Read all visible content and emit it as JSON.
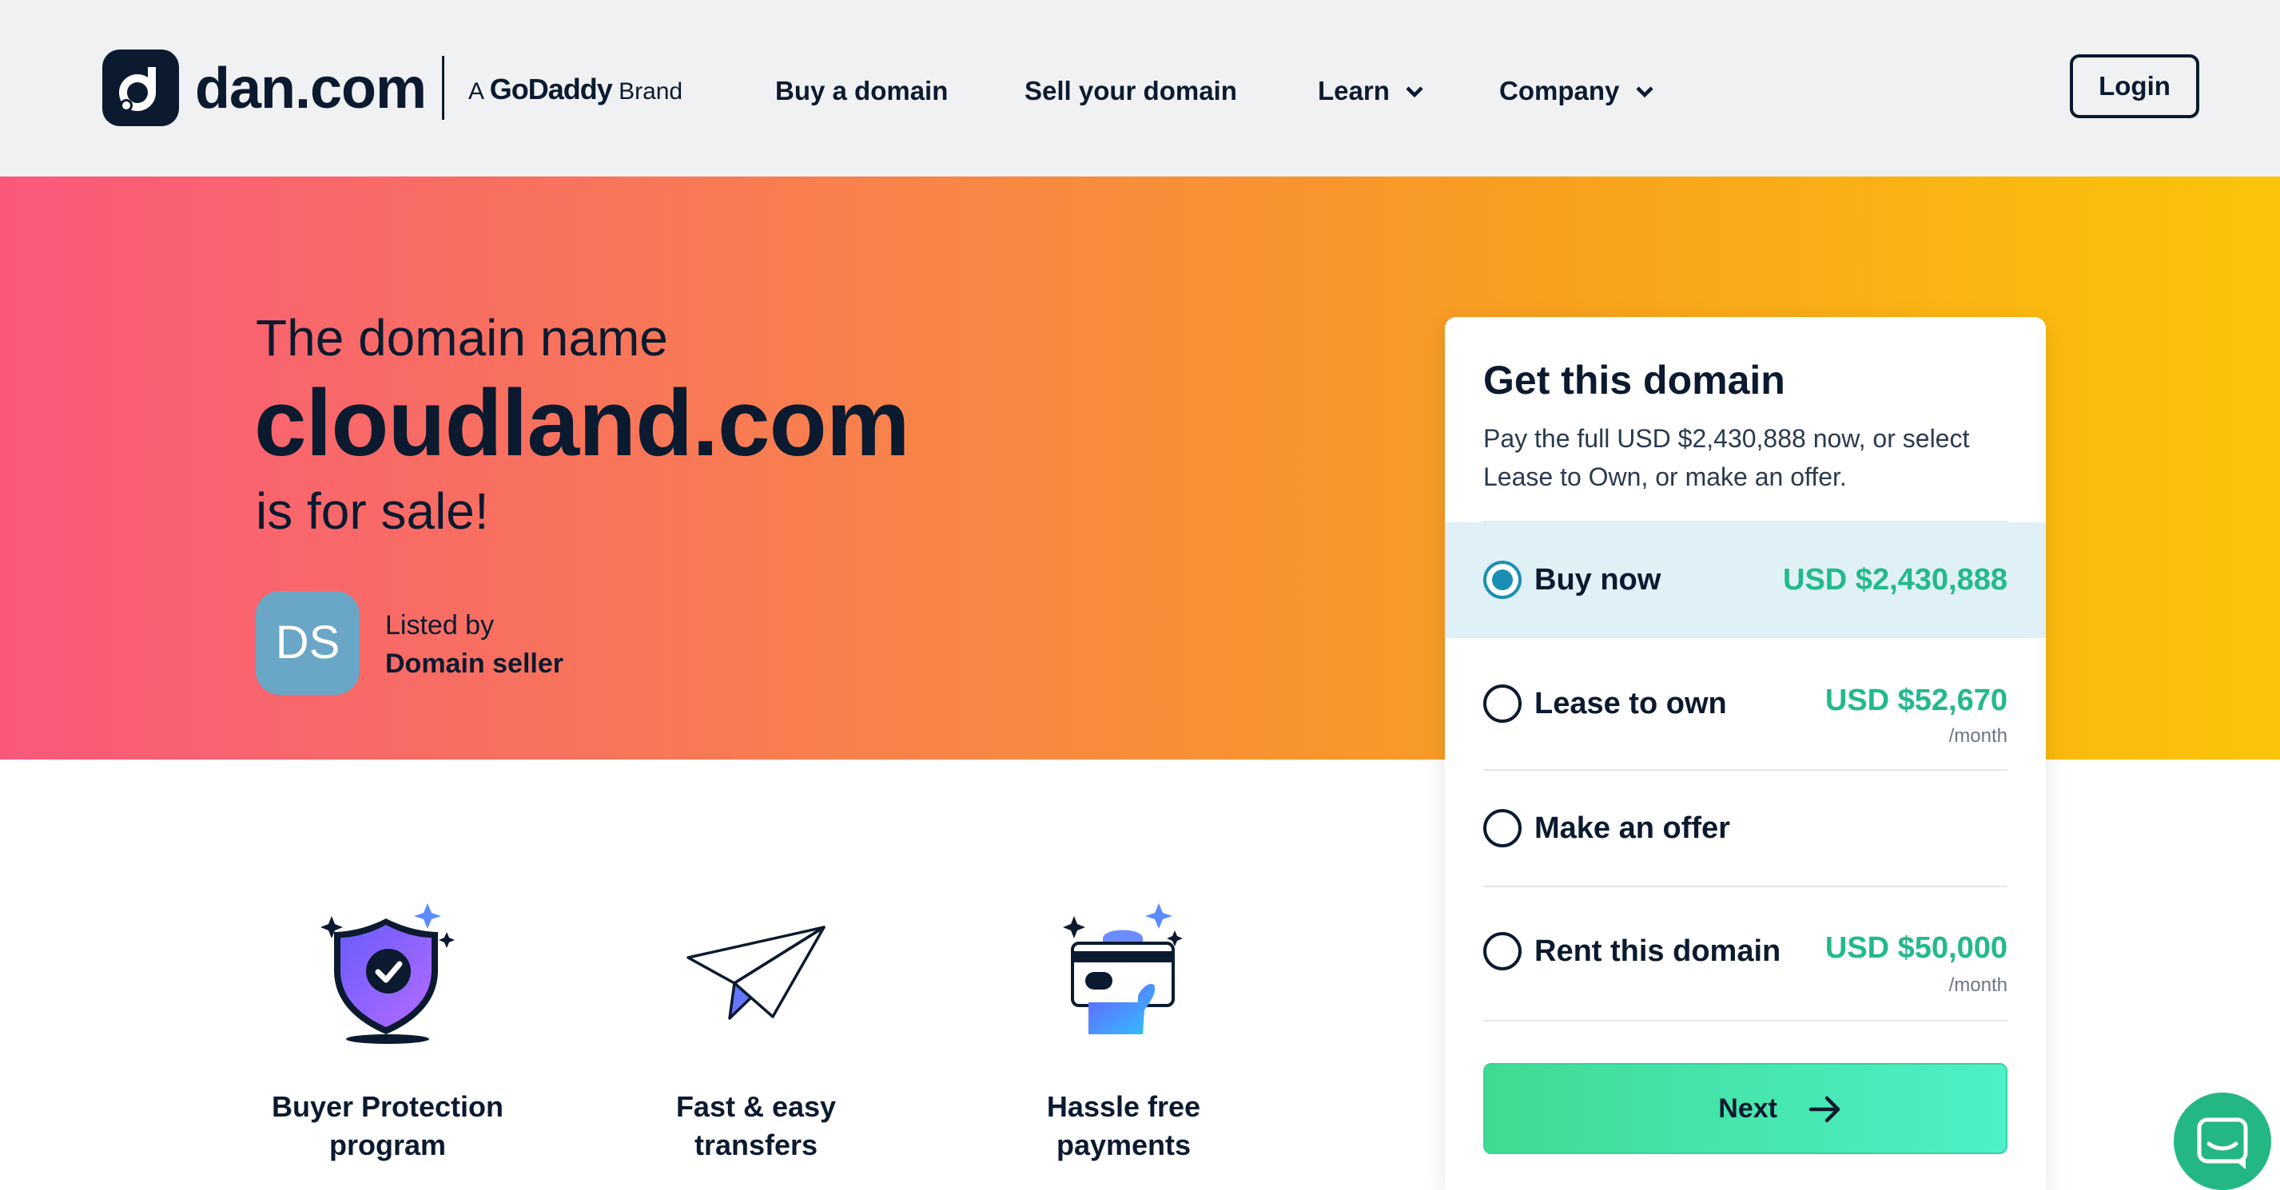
{
  "header": {
    "logo_text": "dan.com",
    "brand_prefix": "A",
    "brand_name": "GoDaddy",
    "brand_suffix": "Brand",
    "nav": [
      {
        "label": "Buy a domain"
      },
      {
        "label": "Sell your domain"
      },
      {
        "label": "Learn",
        "icon": "chevron-down-icon"
      },
      {
        "label": "Company",
        "icon": "chevron-down-icon"
      }
    ],
    "login_label": "Login"
  },
  "hero": {
    "kicker": "The domain name",
    "domain": "cloudland.com",
    "sale_text": "is for sale!",
    "avatar_initials": "DS",
    "listed_by": "Listed by",
    "seller": "Domain seller"
  },
  "card": {
    "title": "Get this domain",
    "description": "Pay the full USD $2,430,888 now, or select Lease to Own, or make an offer.",
    "options": [
      {
        "label": "Buy now",
        "price": "USD $2,430,888",
        "unit": "",
        "selected": true
      },
      {
        "label": "Lease to own",
        "price": "USD $52,670",
        "unit": "/month",
        "selected": false
      },
      {
        "label": "Make an offer",
        "price": "",
        "unit": "",
        "selected": false
      },
      {
        "label": "Rent this domain",
        "price": "USD $50,000",
        "unit": "/month",
        "selected": false
      }
    ],
    "next_label": "Next"
  },
  "features": [
    {
      "icon": "shield-check-icon",
      "line1": "Buyer Protection",
      "line2": "program"
    },
    {
      "icon": "paper-plane-icon",
      "line1": "Fast & easy",
      "line2": "transfers"
    },
    {
      "icon": "card-hand-icon",
      "line1": "Hassle free",
      "line2": "payments"
    }
  ],
  "colors": {
    "navy": "#0b1a2f",
    "price_green": "#22b98c",
    "selected_bg": "#dff1f6",
    "radio_blue": "#1b8fb3",
    "gradient_start": "#f9587c",
    "gradient_end": "#fbc50a"
  }
}
